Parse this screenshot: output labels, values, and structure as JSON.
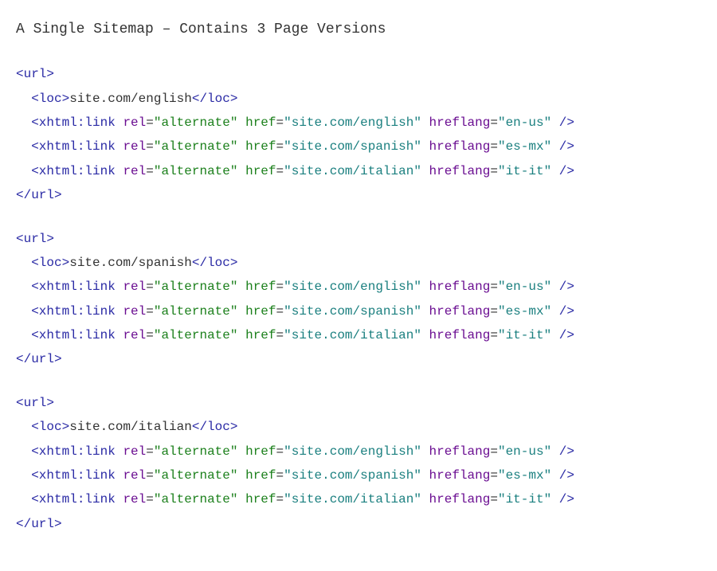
{
  "title": "A Single Sitemap – Contains 3 Page Versions",
  "tags": {
    "url_open": "<url>",
    "url_close": "</url>",
    "loc_open": "<loc>",
    "loc_close": "</loc>",
    "xhtml_link": "<xhtml:link",
    "self_close": " />"
  },
  "attrs": {
    "rel_name": "rel",
    "href_name": "href",
    "hreflang_name": "hreflang"
  },
  "blocks": [
    {
      "loc": "site.com/english",
      "links": [
        {
          "rel": "\"alternate\"",
          "href": "\"site.com/english\"",
          "hreflang": "\"en-us\""
        },
        {
          "rel": "\"alternate\"",
          "href": "\"site.com/spanish\"",
          "hreflang": "\"es-mx\""
        },
        {
          "rel": "\"alternate\"",
          "href": "\"site.com/italian\"",
          "hreflang": "\"it-it\""
        }
      ]
    },
    {
      "loc": "site.com/spanish",
      "links": [
        {
          "rel": "\"alternate\"",
          "href": "\"site.com/english\"",
          "hreflang": "\"en-us\""
        },
        {
          "rel": "\"alternate\"",
          "href": "\"site.com/spanish\"",
          "hreflang": "\"es-mx\""
        },
        {
          "rel": "\"alternate\"",
          "href": "\"site.com/italian\"",
          "hreflang": "\"it-it\""
        }
      ]
    },
    {
      "loc": "site.com/italian",
      "links": [
        {
          "rel": "\"alternate\"",
          "href": "\"site.com/english\"",
          "hreflang": "\"en-us\""
        },
        {
          "rel": "\"alternate\"",
          "href": "\"site.com/spanish\"",
          "hreflang": "\"es-mx\""
        },
        {
          "rel": "\"alternate\"",
          "href": "\"site.com/italian\"",
          "hreflang": "\"it-it\""
        }
      ]
    }
  ]
}
